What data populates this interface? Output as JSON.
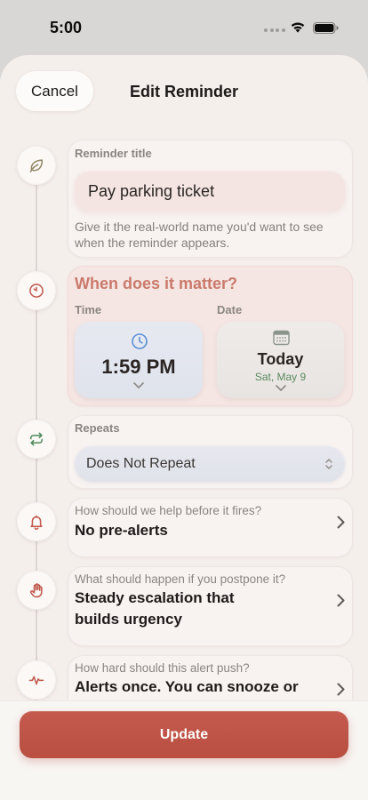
{
  "status_bar": {
    "time": "5:00",
    "icons": [
      "signal-dots-icon",
      "wifi-icon",
      "battery-icon"
    ]
  },
  "header": {
    "cancel_label": "Cancel",
    "title": "Edit Reminder"
  },
  "title_section": {
    "icon": "leaf-icon",
    "label": "Reminder title",
    "value": "Pay parking ticket",
    "helper": "Give it the real-world name you'd want to see when the reminder appears."
  },
  "when_section": {
    "icon": "clock-icon",
    "heading": "When does it matter?",
    "time": {
      "label": "Time",
      "value": "1:59 PM",
      "icon": "clock-icon"
    },
    "date": {
      "label": "Date",
      "value": "Today",
      "subtitle": "Sat, May 9",
      "icon": "calendar-icon"
    }
  },
  "repeat_section": {
    "icon": "repeat-icon",
    "label": "Repeats",
    "value": "Does Not Repeat"
  },
  "prealert_section": {
    "icon": "bell-icon",
    "question": "How should we help before it fires?",
    "value": "No pre-alerts"
  },
  "postpone_section": {
    "icon": "hand-icon",
    "question": "What should happen if you postpone it?",
    "value": "Steady escalation that builds urgency"
  },
  "intensity_section": {
    "icon": "pulse-icon",
    "question": "How hard should this alert push?",
    "value": "Alerts once. You can snooze or"
  },
  "footer": {
    "update_label": "Update"
  },
  "colors": {
    "accent": "#b94e41",
    "heading": "#c97a6b",
    "time_icon": "#5b8ed6",
    "date_subtitle": "#5a8a5e",
    "repeat_icon": "#4f8a5c",
    "alert_icon": "#c0564b",
    "leaf_icon": "#8f8464"
  }
}
